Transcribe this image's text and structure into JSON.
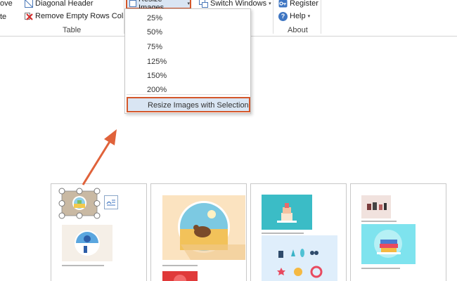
{
  "ribbon": {
    "table_group": {
      "label": "Table",
      "move_cut": "ove",
      "paste_cut": "te",
      "diagonal_header": "Diagonal Header",
      "remove_empty_rows_cols": "Remove Empty Rows Cols"
    },
    "resize_images": "Resize Images",
    "switch_windows": "Switch Windows",
    "about_group": {
      "label": "About",
      "register": "Register",
      "help": "Help"
    }
  },
  "dropdown": {
    "items": [
      "25%",
      "50%",
      "75%",
      "125%",
      "150%",
      "200%"
    ],
    "resize_with_selection": "Resize Images with Selection"
  },
  "colors": {
    "highlight_border": "#d4572a",
    "arrow": "#e0623a",
    "menu_highlight_bg": "#d9e5f3",
    "ribbon_icon_blue": "#3f76c2"
  },
  "icons": {
    "diagonal_header": "diagonal-header-icon",
    "remove_empty": "red-x-icon",
    "resize_images": "resize-icon",
    "switch_windows": "windows-icon",
    "register": "key-icon",
    "help": "help-icon"
  }
}
